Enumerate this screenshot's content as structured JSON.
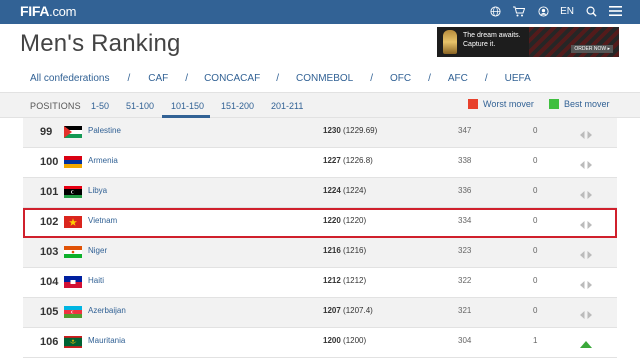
{
  "header": {
    "logo_main": "FIFA",
    "logo_suffix": ".com",
    "lang": "EN",
    "icons": [
      "globe-icon",
      "cart-icon",
      "user-icon",
      "search-icon",
      "menu-icon"
    ]
  },
  "page": {
    "title": "Men's Ranking"
  },
  "ad": {
    "line1": "The dream awaits.",
    "line2": "Capture it.",
    "cta": "ORDER NOW ▸"
  },
  "confederations": [
    "All confederations",
    "CAF",
    "CONCACAF",
    "CONMEBOL",
    "OFC",
    "AFC",
    "UEFA"
  ],
  "positions": {
    "label": "POSITIONS",
    "tabs": [
      "1-50",
      "51-100",
      "101-150",
      "151-200",
      "201-211"
    ],
    "active": "101-150"
  },
  "legend": {
    "worst": {
      "label": "Worst mover",
      "color": "#e8412c"
    },
    "best": {
      "label": "Best mover",
      "color": "#3fbf3f"
    }
  },
  "rows": [
    {
      "rank": "99",
      "country": "Palestine",
      "points": "1230",
      "points_prev": "(1229.69)",
      "prev_rank": "347",
      "move": "0",
      "trend": "same",
      "flag": "palestine"
    },
    {
      "rank": "100",
      "country": "Armenia",
      "points": "1227",
      "points_prev": "(1226.8)",
      "prev_rank": "338",
      "move": "0",
      "trend": "same",
      "flag": "armenia"
    },
    {
      "rank": "101",
      "country": "Libya",
      "points": "1224",
      "points_prev": "(1224)",
      "prev_rank": "336",
      "move": "0",
      "trend": "same",
      "flag": "libya"
    },
    {
      "rank": "102",
      "country": "Vietnam",
      "points": "1220",
      "points_prev": "(1220)",
      "prev_rank": "334",
      "move": "0",
      "trend": "same",
      "flag": "vietnam",
      "highlight": true
    },
    {
      "rank": "103",
      "country": "Niger",
      "points": "1216",
      "points_prev": "(1216)",
      "prev_rank": "323",
      "move": "0",
      "trend": "same",
      "flag": "niger"
    },
    {
      "rank": "104",
      "country": "Haiti",
      "points": "1212",
      "points_prev": "(1212)",
      "prev_rank": "322",
      "move": "0",
      "trend": "same",
      "flag": "haiti"
    },
    {
      "rank": "105",
      "country": "Azerbaijan",
      "points": "1207",
      "points_prev": "(1207.4)",
      "prev_rank": "321",
      "move": "0",
      "trend": "same",
      "flag": "azerbaijan"
    },
    {
      "rank": "106",
      "country": "Mauritania",
      "points": "1200",
      "points_prev": "(1200)",
      "prev_rank": "304",
      "move": "1",
      "trend": "up",
      "flag": "mauritania"
    }
  ]
}
